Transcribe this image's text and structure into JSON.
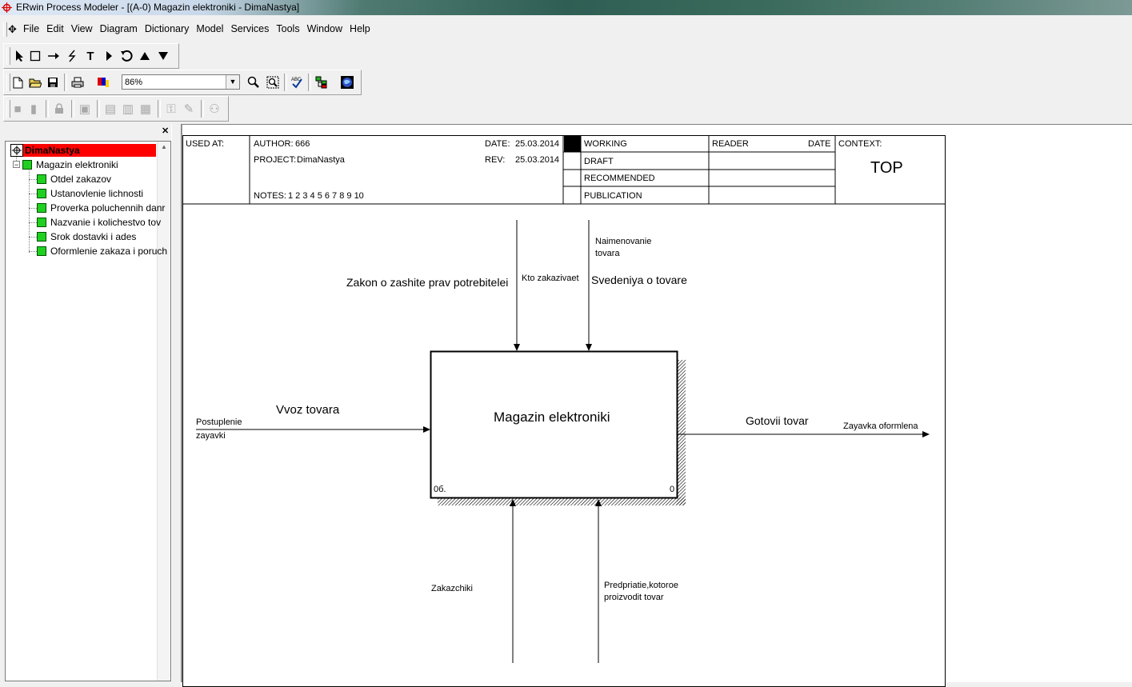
{
  "window": {
    "title": "ERwin Process Modeler - [(A-0) Magazin elektroniki - DimaNastya]"
  },
  "menu": [
    "File",
    "Edit",
    "View",
    "Diagram",
    "Dictionary",
    "Model",
    "Services",
    "Tools",
    "Window",
    "Help"
  ],
  "toolbar": {
    "zoom": "86%"
  },
  "tree": {
    "root": "DimaNastya",
    "node": "Magazin elektroniki",
    "children": [
      "Otdel zakazov",
      "Ustanovlenie lichnosti",
      "Proverka poluchennih danr",
      "Nazvanie  i kolichestvo  tov",
      "Srok dostavki  i ades",
      "Oformlenie zakaza  i poruch"
    ]
  },
  "header": {
    "used_at": "USED AT:",
    "author_label": "AUTHOR:",
    "author": "666",
    "project_label": "PROJECT:",
    "project": "DimaNastya",
    "notes_label": "NOTES:",
    "notes": "1  2  3  4  5  6  7  8  9  10",
    "date_label": "DATE:",
    "date": "25.03.2014",
    "rev_label": "REV:",
    "rev": "25.03.2014",
    "status": [
      "WORKING",
      "DRAFT",
      "RECOMMENDED",
      "PUBLICATION"
    ],
    "reader": "READER",
    "reader_date": "DATE",
    "context_label": "CONTEXT:",
    "context": "TOP"
  },
  "diagram": {
    "box_title": "Magazin elektroniki",
    "box_left": "0б.",
    "box_right": "0",
    "arrows": {
      "control1_main": "Zakon o zashite prav potrebitelei",
      "control1_small": "Kto zakazivaet",
      "control2_small1": "Naimenovanie",
      "control2_small2": "tovara",
      "control2_main": "Svedeniya o tovare",
      "input_small1": "Postuplenie",
      "input_small2": "zayavki",
      "input_main": "Vvoz tovara",
      "output_main": "Gotovii tovar",
      "output_small": "Zayavka oformlena",
      "mech1": "Zakazchiki",
      "mech2_1": "Predpriatie,kotoroe",
      "mech2_2": "proizvodit tovar"
    }
  }
}
